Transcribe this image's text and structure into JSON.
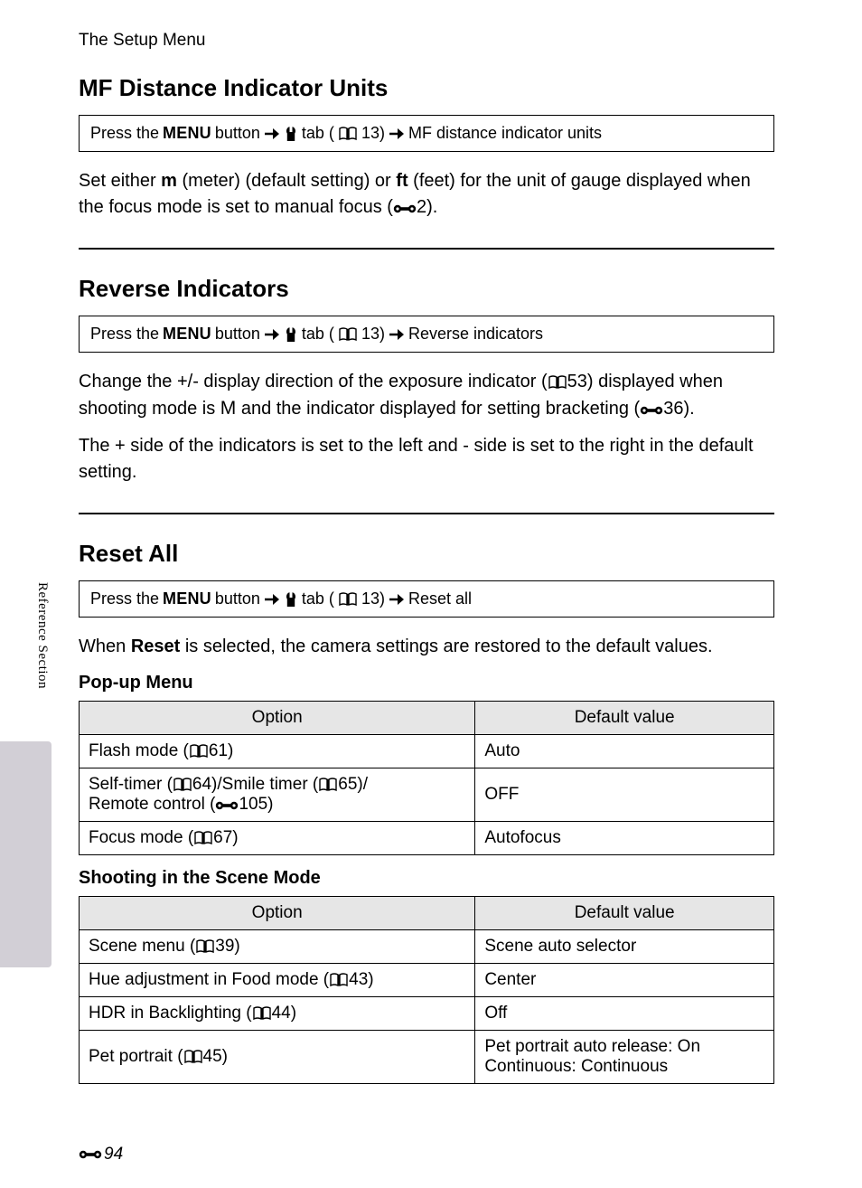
{
  "chapter": "The Setup Menu",
  "sidebar_label": "Reference Section",
  "page_number": "94",
  "nav_common": {
    "press_the": "Press the",
    "menu": "MENU",
    "button": "button",
    "tab": "tab (",
    "tab_ref": "13)"
  },
  "sections": [
    {
      "title": "MF Distance Indicator Units",
      "nav_final": "MF distance indicator units",
      "paragraphs": [
        {
          "parts": [
            {
              "t": "text",
              "v": "Set either "
            },
            {
              "t": "b",
              "v": "m"
            },
            {
              "t": "text",
              "v": " (meter) (default setting) or "
            },
            {
              "t": "b",
              "v": "ft"
            },
            {
              "t": "text",
              "v": " (feet) for the unit of gauge displayed when the focus mode is set to manual focus ("
            },
            {
              "t": "ref-icon"
            },
            {
              "t": "text",
              "v": "2)."
            }
          ]
        }
      ]
    },
    {
      "title": "Reverse Indicators",
      "nav_final": "Reverse indicators",
      "paragraphs": [
        {
          "parts": [
            {
              "t": "text",
              "v": "Change the +/- display direction of the exposure indicator ("
            },
            {
              "t": "book-icon"
            },
            {
              "t": "text",
              "v": "53) displayed when shooting mode is "
            },
            {
              "t": "mode-M",
              "v": "M"
            },
            {
              "t": "text",
              "v": " and the indicator displayed for setting bracketing ("
            },
            {
              "t": "ref-icon"
            },
            {
              "t": "text",
              "v": "36)."
            }
          ]
        },
        {
          "parts": [
            {
              "t": "text",
              "v": "The + side of the indicators is set to the left and - side is set to the right in the default setting."
            }
          ]
        }
      ]
    },
    {
      "title": "Reset All",
      "nav_final": "Reset all",
      "paragraphs": [
        {
          "parts": [
            {
              "t": "text",
              "v": "When "
            },
            {
              "t": "b",
              "v": "Reset"
            },
            {
              "t": "text",
              "v": " is selected, the camera settings are restored to the default values."
            }
          ]
        }
      ],
      "tables": [
        {
          "subhead": "Pop-up Menu",
          "headers": [
            "Option",
            "Default value"
          ],
          "rows": [
            {
              "option_parts": [
                {
                  "t": "text",
                  "v": "Flash mode ("
                },
                {
                  "t": "book-icon"
                },
                {
                  "t": "text",
                  "v": "61)"
                }
              ],
              "value": "Auto"
            },
            {
              "option_parts": [
                {
                  "t": "text",
                  "v": "Self-timer ("
                },
                {
                  "t": "book-icon"
                },
                {
                  "t": "text",
                  "v": "64)/Smile timer ("
                },
                {
                  "t": "book-icon"
                },
                {
                  "t": "text",
                  "v": "65)/"
                },
                {
                  "t": "br"
                },
                {
                  "t": "text",
                  "v": "Remote control ("
                },
                {
                  "t": "ref-icon"
                },
                {
                  "t": "text",
                  "v": "105)"
                }
              ],
              "value": "OFF"
            },
            {
              "option_parts": [
                {
                  "t": "text",
                  "v": "Focus mode ("
                },
                {
                  "t": "book-icon"
                },
                {
                  "t": "text",
                  "v": "67)"
                }
              ],
              "value": "Autofocus"
            }
          ]
        },
        {
          "subhead": "Shooting in the Scene Mode",
          "headers": [
            "Option",
            "Default value"
          ],
          "rows": [
            {
              "option_parts": [
                {
                  "t": "text",
                  "v": "Scene menu ("
                },
                {
                  "t": "book-icon"
                },
                {
                  "t": "text",
                  "v": "39)"
                }
              ],
              "value": "Scene auto selector"
            },
            {
              "option_parts": [
                {
                  "t": "text",
                  "v": "Hue adjustment in Food mode ("
                },
                {
                  "t": "book-icon"
                },
                {
                  "t": "text",
                  "v": "43)"
                }
              ],
              "value": "Center"
            },
            {
              "option_parts": [
                {
                  "t": "text",
                  "v": "HDR in Backlighting ("
                },
                {
                  "t": "book-icon"
                },
                {
                  "t": "text",
                  "v": "44)"
                }
              ],
              "value": "Off"
            },
            {
              "option_parts": [
                {
                  "t": "text",
                  "v": "Pet portrait ("
                },
                {
                  "t": "book-icon"
                },
                {
                  "t": "text",
                  "v": "45)"
                }
              ],
              "value": "Pet portrait auto release: On\nContinuous: Continuous"
            }
          ]
        }
      ]
    }
  ]
}
